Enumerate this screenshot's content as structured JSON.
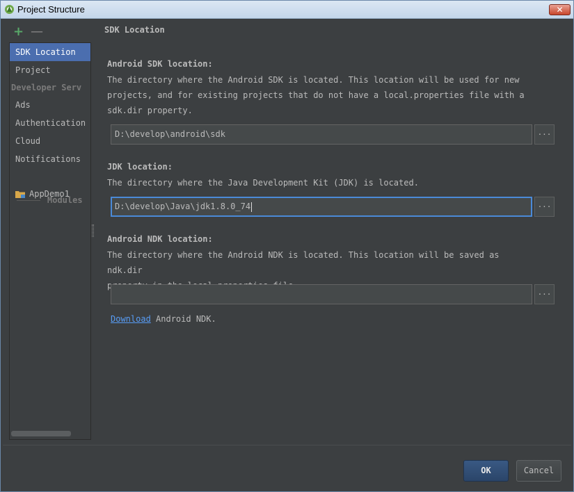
{
  "window": {
    "title": "Project Structure",
    "close_label": "✕"
  },
  "toolbar": {
    "add_label": "+",
    "remove_label": "—"
  },
  "sidebar": {
    "items": [
      {
        "label": "SDK Location",
        "selected": true
      },
      {
        "label": "Project"
      }
    ],
    "developer_section": "Developer Serv",
    "developer_items": [
      {
        "label": "Ads"
      },
      {
        "label": "Authentication"
      },
      {
        "label": "Cloud"
      },
      {
        "label": "Notifications"
      }
    ],
    "modules_label": "Modules",
    "modules": [
      {
        "label": "AppDemo1"
      }
    ]
  },
  "main": {
    "heading": "SDK Location",
    "android_sdk": {
      "title": "Android SDK location:",
      "desc_lines": [
        "The directory where the Android SDK is located. This location will be used for new",
        "projects, and for existing projects that do not have a local.properties file with a",
        "sdk.dir property."
      ],
      "value": "D:\\develop\\android\\sdk",
      "browse_label": "..."
    },
    "jdk": {
      "title": "JDK location:",
      "desc_lines": [
        "The directory where the Java Development Kit (JDK) is located."
      ],
      "value": "D:\\develop\\Java\\jdk1.8.0_74",
      "browse_label": "..."
    },
    "ndk": {
      "title": "Android NDK location:",
      "desc_lines": [
        "The directory where the Android NDK is located. This location will be saved as ndk.dir",
        "property in the local.properties file."
      ],
      "value": "",
      "browse_label": "...",
      "download_link": "Download",
      "download_suffix": " Android NDK."
    }
  },
  "footer": {
    "ok_label": "OK",
    "cancel_label": "Cancel"
  },
  "colors": {
    "background": "#3c3f41",
    "selection": "#4b6eaf",
    "link": "#589df6",
    "focus": "#4a8ad8"
  }
}
